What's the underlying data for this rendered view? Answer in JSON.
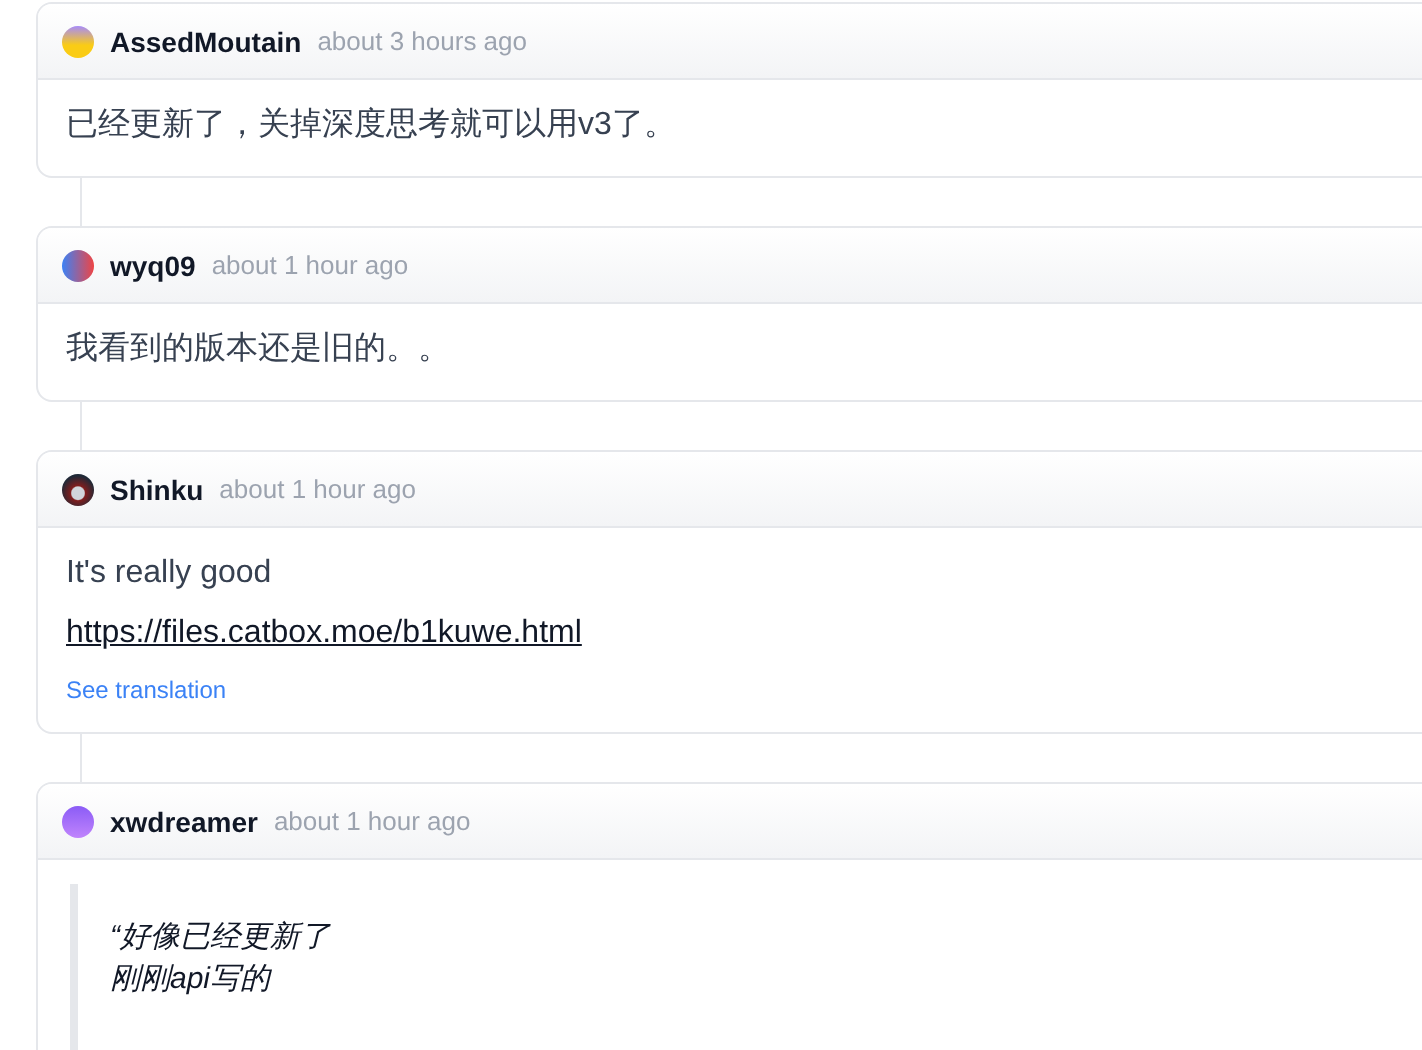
{
  "comments": [
    {
      "author": "AssedMoutain",
      "time": "about 3 hours ago",
      "body": [
        {
          "kind": "text",
          "text": "已经更新了，关掉深度思考就可以用v3了。"
        }
      ]
    },
    {
      "author": "wyq09",
      "time": "about 1 hour ago",
      "body": [
        {
          "kind": "text",
          "text": "我看到的版本还是旧的。。"
        }
      ]
    },
    {
      "author": "Shinku",
      "time": "about 1 hour ago",
      "body": [
        {
          "kind": "text",
          "text": "It's really good"
        },
        {
          "kind": "link",
          "text": "https://files.catbox.moe/b1kuwe.html"
        },
        {
          "kind": "translate",
          "text": "See translation"
        }
      ]
    },
    {
      "author": "xwdreamer",
      "time": "about 1 hour ago",
      "body": [
        {
          "kind": "quote",
          "lines": [
            "“好像已经更新了",
            "刚刚api写的"
          ]
        }
      ]
    }
  ]
}
